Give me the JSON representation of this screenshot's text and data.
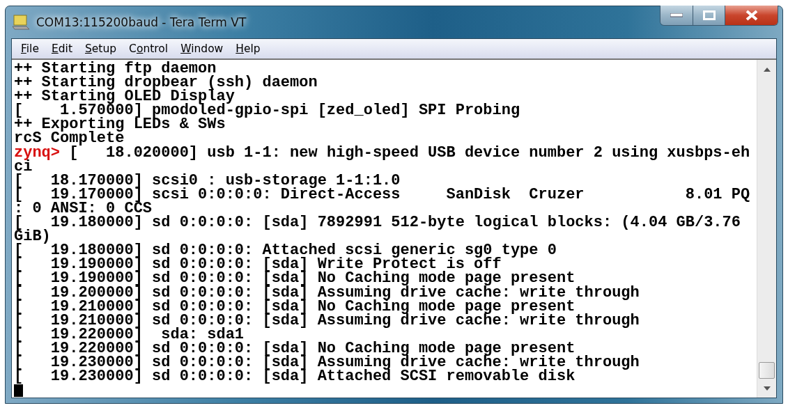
{
  "window": {
    "title": "COM13:115200baud - Tera Term VT"
  },
  "menu": [
    {
      "key": "F",
      "after": "ile"
    },
    {
      "key": "E",
      "after": "dit"
    },
    {
      "key": "S",
      "after": "etup"
    },
    {
      "before": "C",
      "key": "o",
      "after": "ntrol"
    },
    {
      "key": "W",
      "after": "indow"
    },
    {
      "key": "H",
      "after": "elp"
    }
  ],
  "terminal": {
    "lines": [
      {
        "text": "++ Starting ftp daemon"
      },
      {
        "text": "++ Starting dropbear (ssh) daemon"
      },
      {
        "text": "++ Starting OLED Display"
      },
      {
        "text": "[    1.570000] pmodoled-gpio-spi [zed_oled] SPI Probing"
      },
      {
        "text": "++ Exporting LEDs & SWs"
      },
      {
        "text": "rcS Complete"
      },
      {
        "prompt": "zynq>",
        "text": " [   18.020000] usb 1-1: new high-speed USB device number 2 using xusbps-eh"
      },
      {
        "text": "ci"
      },
      {
        "text": "[   18.170000] scsi0 : usb-storage 1-1:1.0"
      },
      {
        "text": "[   19.170000] scsi 0:0:0:0: Direct-Access     SanDisk  Cruzer           8.01 PQ"
      },
      {
        "text": ": 0 ANSI: 0 CCS"
      },
      {
        "text": "[   19.180000] sd 0:0:0:0: [sda] 7892991 512-byte logical blocks: (4.04 GB/3.76"
      },
      {
        "text": "GiB)"
      },
      {
        "text": "[   19.180000] sd 0:0:0:0: Attached scsi generic sg0 type 0"
      },
      {
        "text": "[   19.190000] sd 0:0:0:0: [sda] Write Protect is off"
      },
      {
        "text": "[   19.190000] sd 0:0:0:0: [sda] No Caching mode page present"
      },
      {
        "text": "[   19.200000] sd 0:0:0:0: [sda] Assuming drive cache: write through"
      },
      {
        "text": "[   19.210000] sd 0:0:0:0: [sda] No Caching mode page present"
      },
      {
        "text": "[   19.210000] sd 0:0:0:0: [sda] Assuming drive cache: write through"
      },
      {
        "text": "[   19.220000]  sda: sda1"
      },
      {
        "text": "[   19.220000] sd 0:0:0:0: [sda] No Caching mode page present"
      },
      {
        "text": "[   19.230000] sd 0:0:0:0: [sda] Assuming drive cache: write through"
      },
      {
        "text": "[   19.230000] sd 0:0:0:0: [sda] Attached SCSI removable disk"
      }
    ]
  }
}
